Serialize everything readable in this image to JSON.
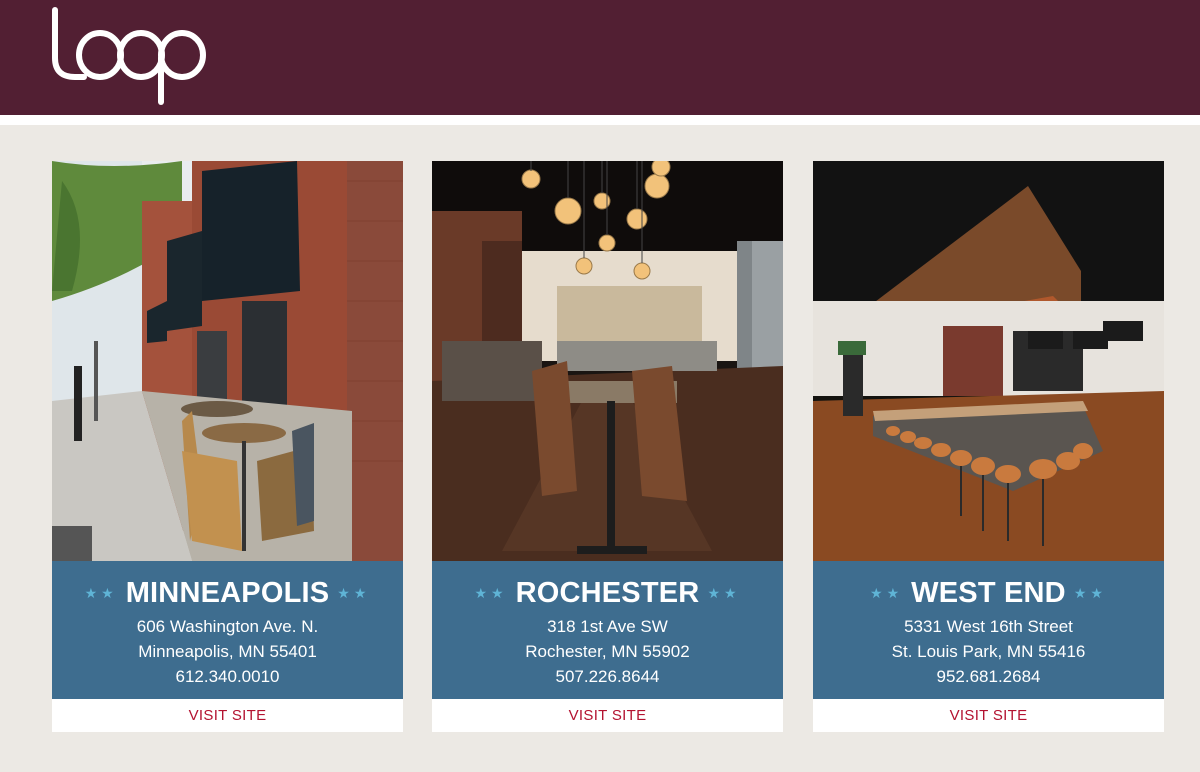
{
  "header": {
    "logo_text": "loop",
    "brand_color": "#521f33"
  },
  "accent": {
    "card_blue": "#3e6d8f",
    "star_color": "#5fb4d6",
    "link_red": "#b31230"
  },
  "locations": [
    {
      "city": "MINNEAPOLIS",
      "address": "606 Washington Ave. N.",
      "city_state_zip": "Minneapolis, MN 55401",
      "phone": "612.340.0010",
      "link": "VISIT SITE",
      "photo": "outdoor patio street view"
    },
    {
      "city": "ROCHESTER",
      "address": "318 1st Ave SW",
      "city_state_zip": "Rochester, MN 55902",
      "phone": "507.226.8644",
      "link": "VISIT SITE",
      "photo": "dining room with pendant lights"
    },
    {
      "city": "WEST END",
      "address": "5331 West 16th Street",
      "city_state_zip": "St. Louis Park, MN 55416",
      "phone": "952.681.2684",
      "link": "VISIT SITE",
      "photo": "bar with stools and wood canopy"
    }
  ]
}
